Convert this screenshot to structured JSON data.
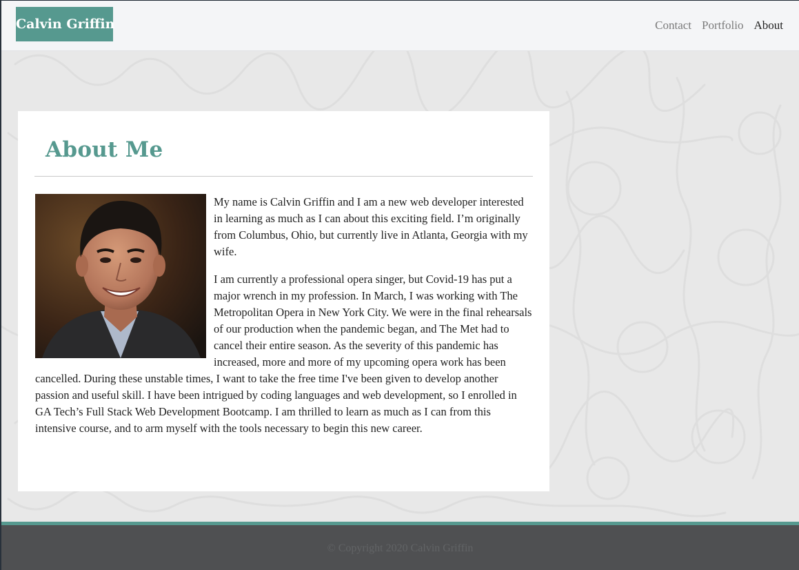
{
  "brand": {
    "name": "Calvin Griffin",
    "color": "#56998f"
  },
  "nav": {
    "items": [
      {
        "label": "Contact",
        "active": false
      },
      {
        "label": "Portfolio",
        "active": false
      },
      {
        "label": "About",
        "active": true
      }
    ]
  },
  "about": {
    "heading": "About Me",
    "photo_alt": "Portrait of Calvin Griffin",
    "paragraphs": [
      "My name is Calvin Griffin and I am a new web developer interested in learning as much as I can about this exciting field. I’m originally from Columbus, Ohio, but currently live in Atlanta, Georgia with my wife.",
      "I am currently a professional opera singer, but Covid-19 has put a major wrench in my profession. In March, I was working with The Metropolitan Opera in New York City. We were in the final rehearsals of our production when the pandemic began, and The Met had to cancel their entire season. As the severity of this pandemic has increased, more and more of my upcoming opera work has been cancelled. During these unstable times, I want to take the free time I've been given to develop another passion and useful skill. I have been intrigued by coding languages and web development, so I enrolled in GA Tech’s Full Stack Web Development Bootcamp. I am thrilled to learn as much as I can from this intensive course, and to arm myself with the tools necessary to begin this new career."
    ]
  },
  "footer": {
    "copyright": "© Copyright 2020 Calvin Griffin"
  },
  "colors": {
    "accent": "#56998f",
    "navbar_bg": "#f4f5f7",
    "page_bg": "#e8e8e8",
    "footer_bg": "#4f5052"
  }
}
